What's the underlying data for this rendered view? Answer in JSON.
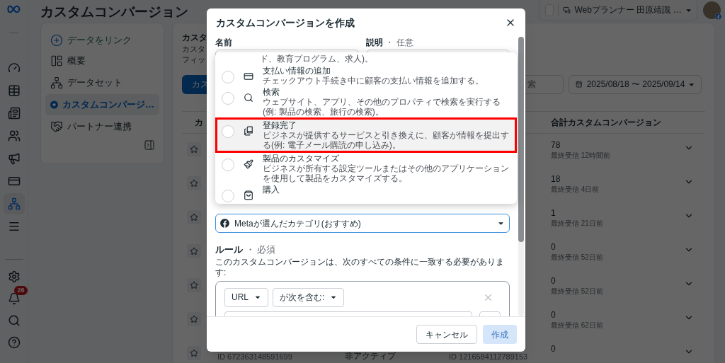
{
  "rail": {
    "items": [
      {
        "kind": "gauge",
        "selected": false
      },
      {
        "kind": "table",
        "selected": false
      },
      {
        "kind": "pages",
        "selected": false
      },
      {
        "kind": "people",
        "selected": false
      },
      {
        "kind": "megaphone",
        "selected": false
      },
      {
        "kind": "card",
        "selected": false
      },
      {
        "kind": "network",
        "selected": true
      },
      {
        "kind": "menu",
        "selected": false
      }
    ],
    "bottom_items": [
      {
        "kind": "settings"
      },
      {
        "kind": "bell",
        "badge": "26"
      },
      {
        "kind": "search"
      },
      {
        "kind": "help"
      }
    ]
  },
  "header": {
    "title": "カスタムコンバージョン",
    "account": "Webプランナー 田原靖識 …"
  },
  "sidebar": {
    "link": "データをリンク",
    "items": [
      {
        "kind": "overview",
        "label": "概要",
        "selected": false
      },
      {
        "kind": "dataset",
        "label": "データセット",
        "selected": false
      },
      {
        "kind": "custom",
        "label": "カスタムコンバージ…",
        "selected": true
      },
      {
        "kind": "partner",
        "label": "パートナー連携",
        "selected": false
      }
    ]
  },
  "panel": {
    "title": "カスタ",
    "subtitle_lines": [
      "カスタ",
      "フィッ"
    ],
    "create_button": "カス",
    "search_placeholder": "索",
    "date_range": "2025/08/18 〜 2025/09/14"
  },
  "table": {
    "columns": [
      "カ",
      "合計カスタムコンバージョン"
    ],
    "rows": [
      {
        "value": "78",
        "last_received": "最終受信 12時間前"
      },
      {
        "value": "18",
        "last_received": "最終受信 4日前"
      },
      {
        "value": "1",
        "last_received": "最終受信 21日前"
      },
      {
        "value": "0",
        "last_received": "最終受信 52日前"
      },
      {
        "value": "0",
        "last_received": "最終受信 52日前"
      },
      {
        "value": "0",
        "last_received": "最終受信 62日前"
      },
      {
        "value": "0",
        "id": "ID 672363148591699",
        "status": "非アクティブ",
        "source_id": "ID 1216584112789153"
      }
    ]
  },
  "dialog": {
    "title": "カスタムコンバージョンを作成",
    "name_label": "名前",
    "description_label": "説明",
    "description_hint": "・ 任意",
    "category_menu": {
      "clipped_text": "ド、教育プログラム、求人)。",
      "items": [
        {
          "kind": "card",
          "title": "支払い情報の追加",
          "description": "チェックアウト手続き中に顧客の支払い情報を追加する。",
          "highlighted": false
        },
        {
          "kind": "search",
          "title": "検索",
          "description": "ウェブサイト、アプリ、その他のプロパティで検索を実行する(例: 製品の検索、旅行の検索)。",
          "highlighted": false
        },
        {
          "kind": "signup",
          "title": "登録完了",
          "description": "ビジネスが提供するサービスと引き換えに、顧客が情報を提出する(例: 電子メール購読の申し込み)。",
          "highlighted": true
        },
        {
          "kind": "brush",
          "title": "製品のカスタマイズ",
          "description": "ビジネスが所有する設定ツールまたはその他のアプリケーションを使用して製品をカスタマイズする。",
          "highlighted": false
        },
        {
          "kind": "bag",
          "title": "購入",
          "highlighted": false
        }
      ]
    },
    "category_select": {
      "value": "Metaが選んだカテゴリ(おすすめ)"
    },
    "rules": {
      "title": "ルール",
      "hint": "・ 必須",
      "description": "このカスタムコンバージョンは、次のすべての条件に一致する必要があります:",
      "field": "URL",
      "operator": "が次を含む:"
    },
    "buttons": [
      {
        "kind": "secondary",
        "label": "キャンセル",
        "disabled": false
      },
      {
        "kind": "primary",
        "label": "作成",
        "disabled": true
      }
    ]
  }
}
